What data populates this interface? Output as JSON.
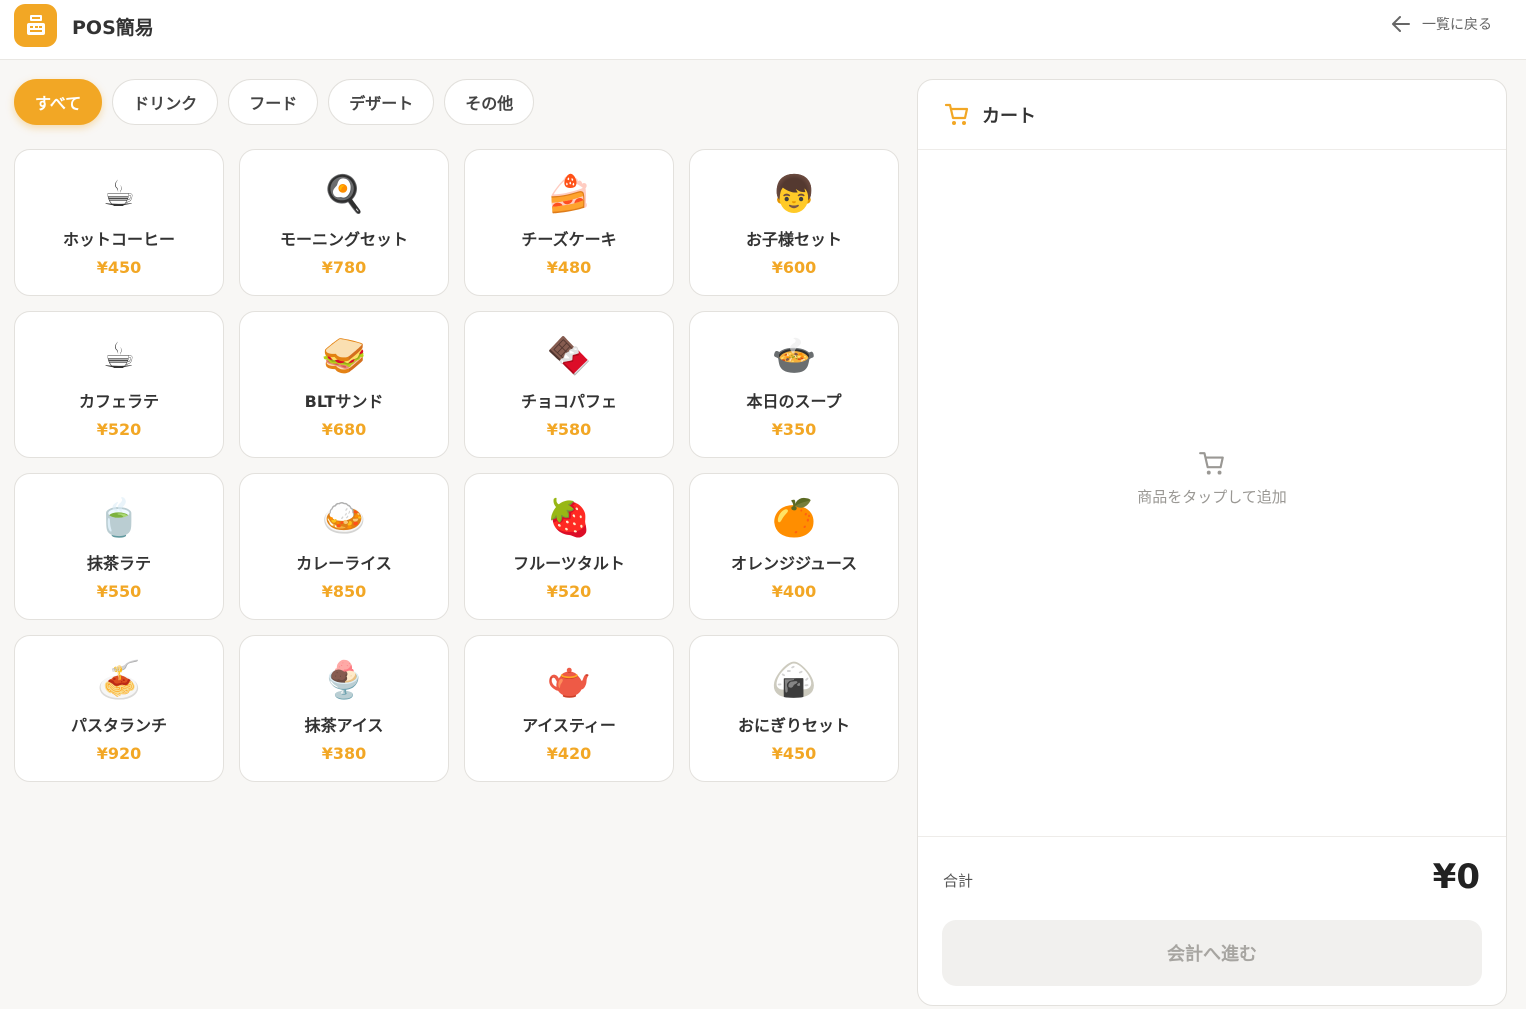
{
  "header": {
    "title": "POS簡易",
    "back_label": "一覧に戻る"
  },
  "tabs": [
    {
      "label": "すべて",
      "active": true
    },
    {
      "label": "ドリンク",
      "active": false
    },
    {
      "label": "フード",
      "active": false
    },
    {
      "label": "デザート",
      "active": false
    },
    {
      "label": "その他",
      "active": false
    }
  ],
  "products": [
    {
      "icon": "☕",
      "icon_name": "hot-coffee-icon",
      "name": "ホットコーヒー",
      "price": "¥450"
    },
    {
      "icon": "🍳",
      "icon_name": "fried-egg-icon",
      "name": "モーニングセット",
      "price": "¥780"
    },
    {
      "icon": "🍰",
      "icon_name": "cake-icon",
      "name": "チーズケーキ",
      "price": "¥480"
    },
    {
      "icon": "👦",
      "icon_name": "child-icon",
      "name": "お子様セット",
      "price": "¥600"
    },
    {
      "icon": "☕",
      "icon_name": "latte-icon",
      "name": "カフェラテ",
      "price": "¥520"
    },
    {
      "icon": "🥪",
      "icon_name": "sandwich-icon",
      "name": "BLTサンド",
      "price": "¥680"
    },
    {
      "icon": "🍫",
      "icon_name": "chocolate-icon",
      "name": "チョコパフェ",
      "price": "¥580"
    },
    {
      "icon": "🍲",
      "icon_name": "soup-icon",
      "name": "本日のスープ",
      "price": "¥350"
    },
    {
      "icon": "🍵",
      "icon_name": "matcha-icon",
      "name": "抹茶ラテ",
      "price": "¥550"
    },
    {
      "icon": "🍛",
      "icon_name": "curry-icon",
      "name": "カレーライス",
      "price": "¥850"
    },
    {
      "icon": "🍓",
      "icon_name": "strawberry-icon",
      "name": "フルーツタルト",
      "price": "¥520"
    },
    {
      "icon": "🍊",
      "icon_name": "orange-icon",
      "name": "オレンジジュース",
      "price": "¥400"
    },
    {
      "icon": "🍝",
      "icon_name": "pasta-icon",
      "name": "パスタランチ",
      "price": "¥920"
    },
    {
      "icon": "🍨",
      "icon_name": "ice-cream-icon",
      "name": "抹茶アイス",
      "price": "¥380"
    },
    {
      "icon": "🫖",
      "icon_name": "teapot-icon",
      "name": "アイスティー",
      "price": "¥420"
    },
    {
      "icon": "🍙",
      "icon_name": "onigiri-icon",
      "name": "おにぎりセット",
      "price": "¥450"
    }
  ],
  "cart": {
    "title": "カート",
    "empty_text": "商品をタップして追加",
    "total_label": "合計",
    "total_value": "¥0",
    "checkout_label": "会計へ進む"
  },
  "colors": {
    "accent": "#f2a725",
    "background": "#f8f7f5"
  }
}
